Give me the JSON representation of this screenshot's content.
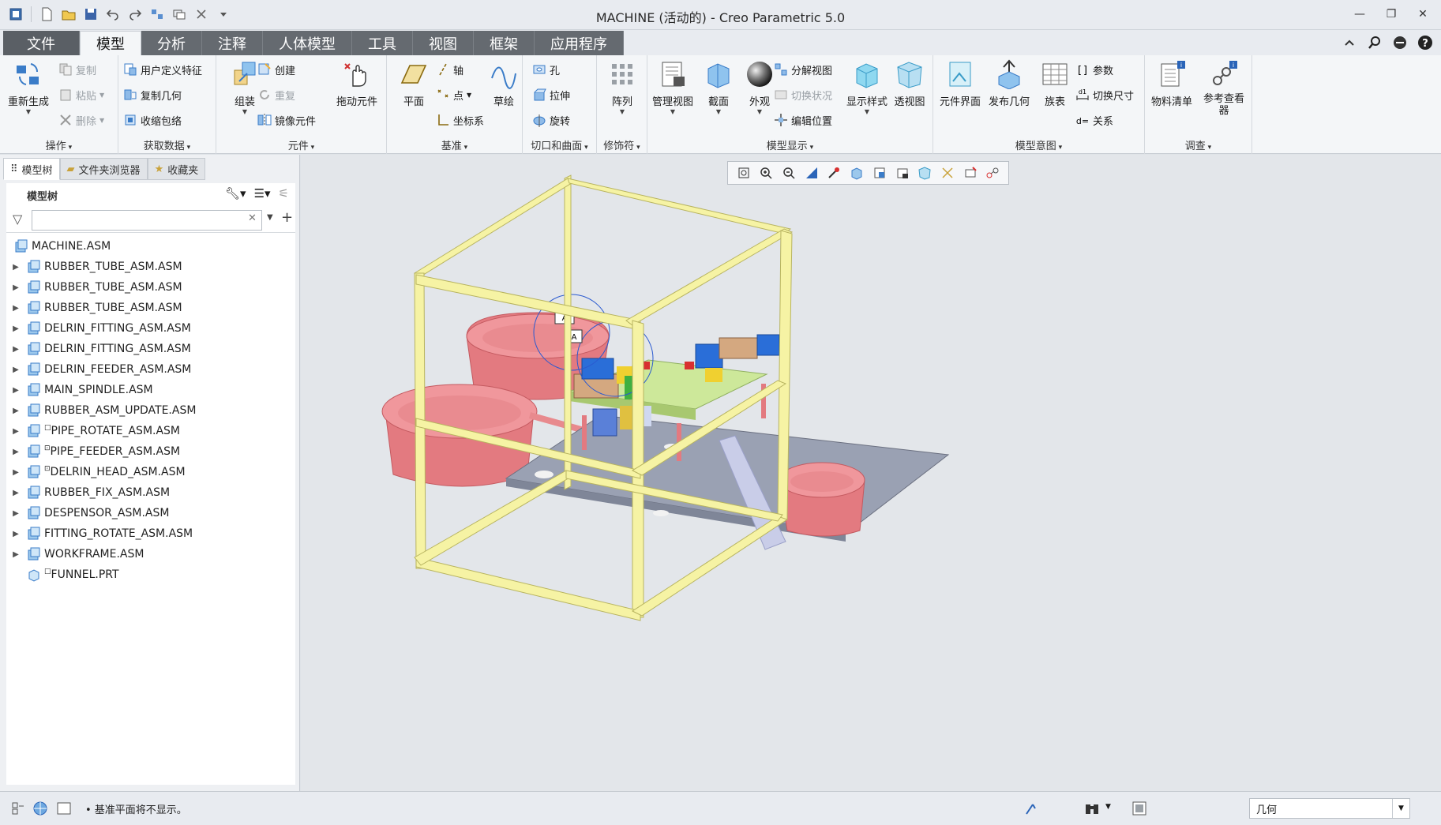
{
  "window": {
    "title": "MACHINE (活动的) - Creo Parametric 5.0"
  },
  "menu": {
    "tabs": [
      "文件",
      "模型",
      "分析",
      "注释",
      "人体模型",
      "工具",
      "视图",
      "框架",
      "应用程序"
    ],
    "active_tab": "模型"
  },
  "ribbon": {
    "operations": {
      "label": "操作",
      "regenerate": "重新生成",
      "copy": "复制",
      "paste": "粘贴",
      "delete": "删除"
    },
    "get_data": {
      "label": "获取数据",
      "udf": "用户定义特征",
      "copy_geom": "复制几何",
      "shrinkwrap": "收缩包络"
    },
    "component": {
      "label": "元件",
      "assemble": "组装",
      "create": "创建",
      "repeat": "重复",
      "mirror": "镜像元件",
      "drag": "拖动元件"
    },
    "datum": {
      "label": "基准",
      "plane": "平面",
      "axis": "轴",
      "point": "点",
      "csys": "坐标系",
      "sketch": "草绘"
    },
    "cut_surface": {
      "label": "切口和曲面",
      "hole": "孔",
      "extrude": "拉伸",
      "revolve": "旋转"
    },
    "modifiers": {
      "label": "修饰符",
      "pattern": "阵列"
    },
    "model_display": {
      "label": "模型显示",
      "manage_views": "管理视图",
      "section": "截面",
      "appearance": "外观",
      "explode": "分解视图",
      "toggle_status": "切换状况",
      "edit_position": "编辑位置",
      "display_style": "显示样式",
      "perspective": "透视图"
    },
    "model_intent": {
      "label": "模型意图",
      "component_interface": "元件界面",
      "publish_geom": "发布几何",
      "family_table": "族表",
      "parameters": "参数",
      "switch_dims": "切换尺寸",
      "relations": "关系"
    },
    "investigate": {
      "label": "调查",
      "bom": "物料清单",
      "ref_viewer": "参考查看器"
    }
  },
  "left_panel": {
    "tabs": [
      "模型树",
      "文件夹浏览器",
      "收藏夹"
    ],
    "tree_header": "模型树",
    "filter_placeholder": "",
    "root": "MACHINE.ASM",
    "items": [
      {
        "name": "RUBBER_TUBE_ASM.ASM",
        "expandable": true,
        "mark": ""
      },
      {
        "name": "RUBBER_TUBE_ASM.ASM",
        "expandable": true,
        "mark": ""
      },
      {
        "name": "RUBBER_TUBE_ASM.ASM",
        "expandable": true,
        "mark": ""
      },
      {
        "name": "DELRIN_FITTING_ASM.ASM",
        "expandable": true,
        "mark": ""
      },
      {
        "name": "DELRIN_FITTING_ASM.ASM",
        "expandable": true,
        "mark": ""
      },
      {
        "name": "DELRIN_FEEDER_ASM.ASM",
        "expandable": true,
        "mark": ""
      },
      {
        "name": "MAIN_SPINDLE.ASM",
        "expandable": true,
        "mark": ""
      },
      {
        "name": "RUBBER_ASM_UPDATE.ASM",
        "expandable": true,
        "mark": ""
      },
      {
        "name": "PIPE_ROTATE_ASM.ASM",
        "expandable": true,
        "mark": "□"
      },
      {
        "name": "PIPE_FEEDER_ASM.ASM",
        "expandable": true,
        "mark": "⊡"
      },
      {
        "name": "DELRIN_HEAD_ASM.ASM",
        "expandable": true,
        "mark": "⊡"
      },
      {
        "name": "RUBBER_FIX_ASM.ASM",
        "expandable": true,
        "mark": ""
      },
      {
        "name": "DESPENSOR_ASM.ASM",
        "expandable": true,
        "mark": ""
      },
      {
        "name": "FITTING_ROTATE_ASM.ASM",
        "expandable": true,
        "mark": ""
      },
      {
        "name": "WORKFRAME.ASM",
        "expandable": true,
        "mark": ""
      },
      {
        "name": "FUNNEL.PRT",
        "expandable": false,
        "mark": "□"
      }
    ]
  },
  "viewport": {
    "toolbar_icons": [
      "refit-icon",
      "zoom-in-icon",
      "zoom-out-icon",
      "repaint-icon",
      "spin-center-icon",
      "display-style-icon",
      "saved-views-icon",
      "view-manager-icon",
      "perspective-icon",
      "datum-display-icon",
      "annotation-display-icon",
      "spin-center-toggle-icon"
    ],
    "annotations": [
      "A",
      "A"
    ]
  },
  "status_bar": {
    "message": "• 基准平面将不显示。",
    "selection_filter": "几何"
  },
  "colors": {
    "frame": "#f6f2a6",
    "bowl": "#ec8a8e",
    "plate": "#9aa2b4",
    "platform": "#cdeb9a",
    "tab_bg": "#656a70",
    "viewport_bg": "#e3e6ea"
  }
}
